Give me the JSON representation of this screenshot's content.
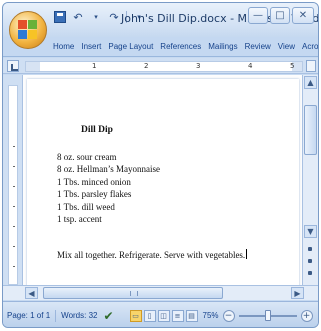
{
  "window": {
    "title": "John's Dill Dip.docx - Microsoft Word",
    "controls": {
      "minimize_icon": "minimize-icon",
      "maximize_icon": "maximize-icon",
      "close_icon": "close-icon"
    }
  },
  "quick_access": {
    "icons": [
      "save-icon",
      "undo-icon",
      "redo-icon",
      "customize-icon"
    ]
  },
  "ribbon": {
    "tabs": [
      "Home",
      "Insert",
      "Page Layout",
      "References",
      "Mailings",
      "Review",
      "View",
      "Acrobat"
    ]
  },
  "ruler": {
    "numbers": [
      "1",
      "2",
      "3",
      "4",
      "5"
    ]
  },
  "document": {
    "title": "Dill Dip",
    "lines": [
      "8 oz. sour cream",
      "8 oz. Hellman’s Mayonnaise",
      "1 Tbs. minced onion",
      "1 Tbs. parsley flakes",
      "1 Tbs. dill weed",
      "1 tsp. accent"
    ],
    "instructions": "Mix all together. Refrigerate. Serve with vegetables."
  },
  "status": {
    "page": "Page: 1 of 1",
    "words": "Words: 32",
    "zoom": "75%",
    "zoom_level": 0.5
  },
  "colors": {
    "accent": "#15428b",
    "ribbon": "#c4d8f1",
    "office_button": "#f2b441"
  }
}
